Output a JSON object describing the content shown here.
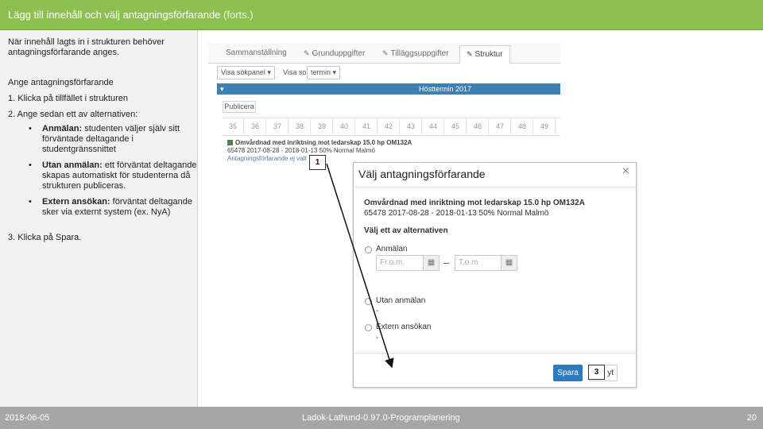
{
  "header": {
    "title": "Lägg till innehåll och välj antagningsförfarande",
    "suffix": "(forts.)"
  },
  "left": {
    "intro": "När innehåll lagts in i strukturen behöver antagningsförfarande anges.",
    "heading": "Ange antagningsförfarande",
    "step1": "1.  Klicka på tillfället i strukturen",
    "step2": "2.  Ange sedan ett av alternativen:",
    "bullets": [
      {
        "label": "Anmälan:",
        "text": "studenten väljer själv sitt förväntade deltagande i studentgränssnittet"
      },
      {
        "label": "Utan anmälan:",
        "text": "ett förväntat deltagande skapas automatiskt för studenterna då strukturen publiceras."
      },
      {
        "label": "Extern ansökan:",
        "text": "förväntat deltagande sker via externt system (ex. NyA)"
      }
    ],
    "bullet_char": "•",
    "step3": "3.  Klicka på Spara."
  },
  "background_screen": {
    "tabs": [
      "Sammanställning",
      "Grunduppgifter",
      "Tilläggsuppgifter",
      "Struktur"
    ],
    "active_tab": "Struktur",
    "pencil": "✎",
    "show_panel": "Visa sökpanel ▾",
    "show_as_label": "Visa som",
    "show_as_value": "termin ▾",
    "term_caret": "▾",
    "term": "Hösttermin 2017",
    "publish": "Publicera",
    "weeks": [
      "35",
      "36",
      "37",
      "38",
      "39",
      "40",
      "41",
      "42",
      "43",
      "44",
      "45",
      "46",
      "47",
      "48",
      "49"
    ],
    "course_name": "Omvårdnad med inriktning mot ledarskap 15.0 hp OM132A",
    "course_details": "65478 2017-08-28 - 2018-01-13 50% Normal Malmö",
    "admission_link": "Antagningsförfarande ej valt"
  },
  "dialog": {
    "title": "Välj antagningsförfarande",
    "close": "×",
    "course_name": "Omvårdnad med inriktning mot ledarskap 15.0 hp OM132A",
    "course_details": "65478 2017-08-28 - 2018-01-13 50% Normal Malmö",
    "subtitle": "Välj ett av alternativen",
    "option1": "Anmälan",
    "from_placeholder": "Fr.o.m.",
    "to_placeholder": "T.o.m",
    "calendar_glyph": "▦",
    "range_sep": "–",
    "option2": "Utan anmälan",
    "option2_sub": "-",
    "option3": "Extern ansökan",
    "option3_sub": "-",
    "save": "Spara",
    "cancel_tail": "yt"
  },
  "markers": {
    "m1": "1",
    "m3": "3"
  },
  "footer": {
    "date": "2018-06-05",
    "center": "Ladok-Lathund-0.97.0-Programplanering",
    "page": "20"
  }
}
